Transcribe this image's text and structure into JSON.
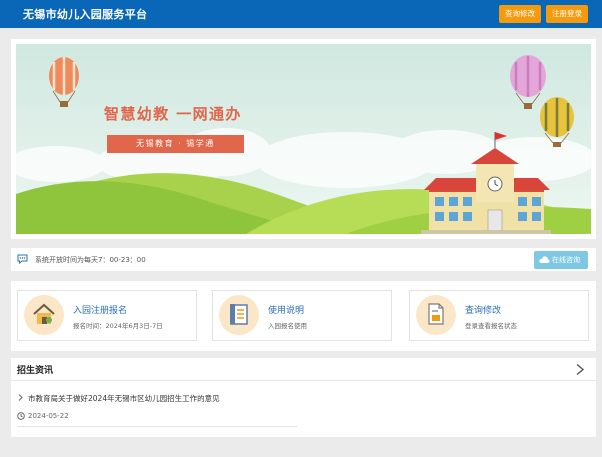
{
  "header": {
    "title": "无锡市幼儿入园服务平台",
    "query_button": "查询修改",
    "register_button": "注册登录"
  },
  "banner": {
    "slogan": "智慧幼教  一网通办",
    "ribbon": "无锡教育 · 锡学通"
  },
  "notice": {
    "text": "系统开放时间为每天7：00-23：00",
    "consult_button": "在线咨询"
  },
  "cards": [
    {
      "title": "入园注册报名",
      "subtitle": "报名时间：2024年6月3日-7日",
      "icon": "house-icon"
    },
    {
      "title": "使用说明",
      "subtitle": "入园报名使用",
      "icon": "document-icon"
    },
    {
      "title": "查询修改",
      "subtitle": "登录查看报名状态",
      "icon": "clipboard-icon"
    }
  ],
  "news": {
    "heading": "招生资讯",
    "items": [
      {
        "title": "市教育局关于做好2024年无锡市区幼儿园招生工作的意见",
        "date": "2024-05-22"
      }
    ]
  },
  "colors": {
    "header_bg": "#0a67b8",
    "accent_orange": "#f39a0e",
    "slogan_red": "#e0674b",
    "card_title_blue": "#2b6fb4",
    "consult_blue": "#7ec8e3"
  }
}
